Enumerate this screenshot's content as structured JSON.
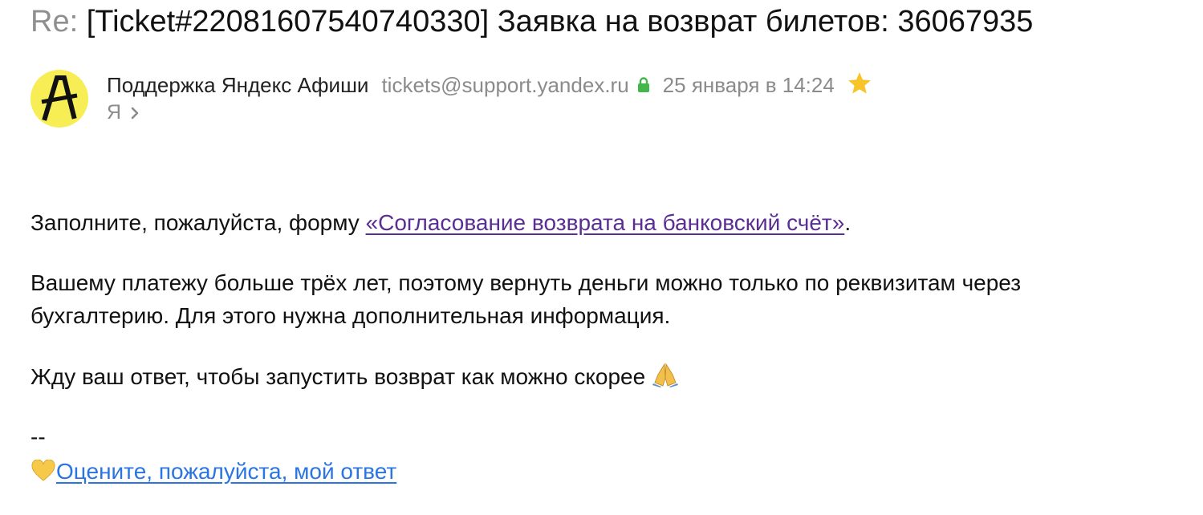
{
  "subject": {
    "prefix": "Re:",
    "text": "[Ticket#22081607540740330] Заявка на возврат билетов: 36067935"
  },
  "sender": {
    "name": "Поддержка Яндекс Афиши",
    "email": "tickets@support.yandex.ru",
    "date": "25 января в 14:24",
    "recipient": "Я",
    "avatar_icon": "afisha-logo-icon",
    "avatar_color": "#f7ee55"
  },
  "body": {
    "p1_before": "Заполните, пожалуйста, форму ",
    "p1_link": "«Согласование возврата на банковский счёт»",
    "p1_after": ".",
    "p2_line1": "Вашему платежу больше трёх лет, поэтому вернуть деньги можно только по реквизитам через",
    "p2_line2": "бухгалтерию. Для этого нужна дополнительная информация.",
    "p3": "Жду ваш ответ, чтобы запустить возврат как можно скорее",
    "p3_emoji": "folded-hands-icon"
  },
  "signature": {
    "dash": "--",
    "rate_emoji": "yellow-heart-icon",
    "rate_link": "Оцените, пожалуйста, мой ответ"
  },
  "colors": {
    "link_visited": "#5a2e93",
    "link": "#2a75e2",
    "muted": "#8b8b8b",
    "star": "#f7c52a",
    "lock": "#43b649"
  }
}
